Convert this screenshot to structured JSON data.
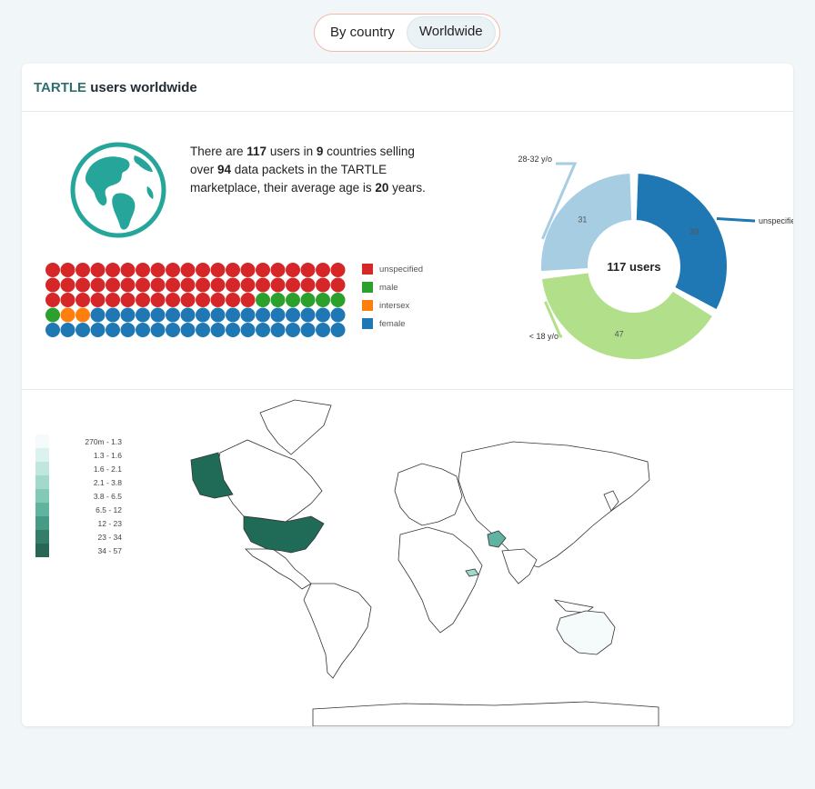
{
  "toggle": {
    "by_country": "By country",
    "worldwide": "Worldwide",
    "active": "Worldwide"
  },
  "card": {
    "title_brand": "TARTLE",
    "title_rest": " users worldwide"
  },
  "summary": {
    "p1": "There are ",
    "users": "117",
    "p2": " users in ",
    "countries": "9",
    "p3": " countries selling over ",
    "packets": "94",
    "p4": " data packets in the TARTLE marketplace, their average age is ",
    "age": "20",
    "p5": " years."
  },
  "globe": {
    "icon": "globe-icon",
    "color": "#26a69a"
  },
  "gender": {
    "legend": [
      {
        "label": "unspecified",
        "color": "#d62728",
        "count": 54
      },
      {
        "label": "male",
        "color": "#2ca02c",
        "count": 7
      },
      {
        "label": "intersex",
        "color": "#ff7f0e",
        "count": 2
      },
      {
        "label": "female",
        "color": "#1f77b4",
        "count": 37
      }
    ]
  },
  "chart_data": {
    "type": "pie",
    "center_label": "117 users",
    "slices": [
      {
        "label": "28-32 y/o",
        "value": 31,
        "color": "#a6cde2"
      },
      {
        "label": "unspecified",
        "value": 39,
        "color": "#1f78b4"
      },
      {
        "label": "< 18 y/o",
        "value": 47,
        "color": "#b2df8a"
      }
    ]
  },
  "map": {
    "scale": [
      {
        "label": "270m - 1.3",
        "color": "#f4fbfa"
      },
      {
        "label": "1.3 - 1.6",
        "color": "#dcf2ee"
      },
      {
        "label": "1.6 - 2.1",
        "color": "#c1e6de"
      },
      {
        "label": "2.1 - 3.8",
        "color": "#a3d9cc"
      },
      {
        "label": "3.8 - 6.5",
        "color": "#83c9b8"
      },
      {
        "label": "6.5 - 12",
        "color": "#60b39e"
      },
      {
        "label": "12 - 23",
        "color": "#459b85"
      },
      {
        "label": "23 - 34",
        "color": "#347d6b"
      },
      {
        "label": "34 - 57",
        "color": "#2a6656"
      }
    ],
    "highlight": "#1f6b57"
  }
}
